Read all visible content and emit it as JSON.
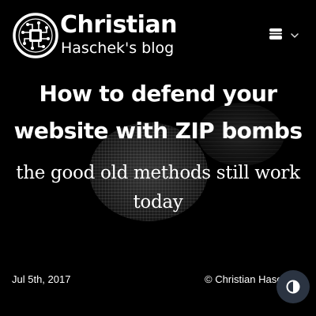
{
  "header": {
    "brand_name": "Christian",
    "brand_tagline": "Haschek's blog",
    "logo_icon": "circuit-chip-logo",
    "menu_icon": "hamburger-icon",
    "menu_chevron": "chevron-down-icon"
  },
  "post": {
    "title": "How to defend your website with ZIP bombs",
    "subtitle": "the good old methods still work today",
    "date": "Jul 5th, 2017",
    "copyright": "© Christian Haschek"
  },
  "theme_toggle": {
    "icon": "contrast-icon",
    "background": "#2b3442"
  },
  "colors": {
    "page_background": "#000000",
    "text": "#ffffff"
  }
}
